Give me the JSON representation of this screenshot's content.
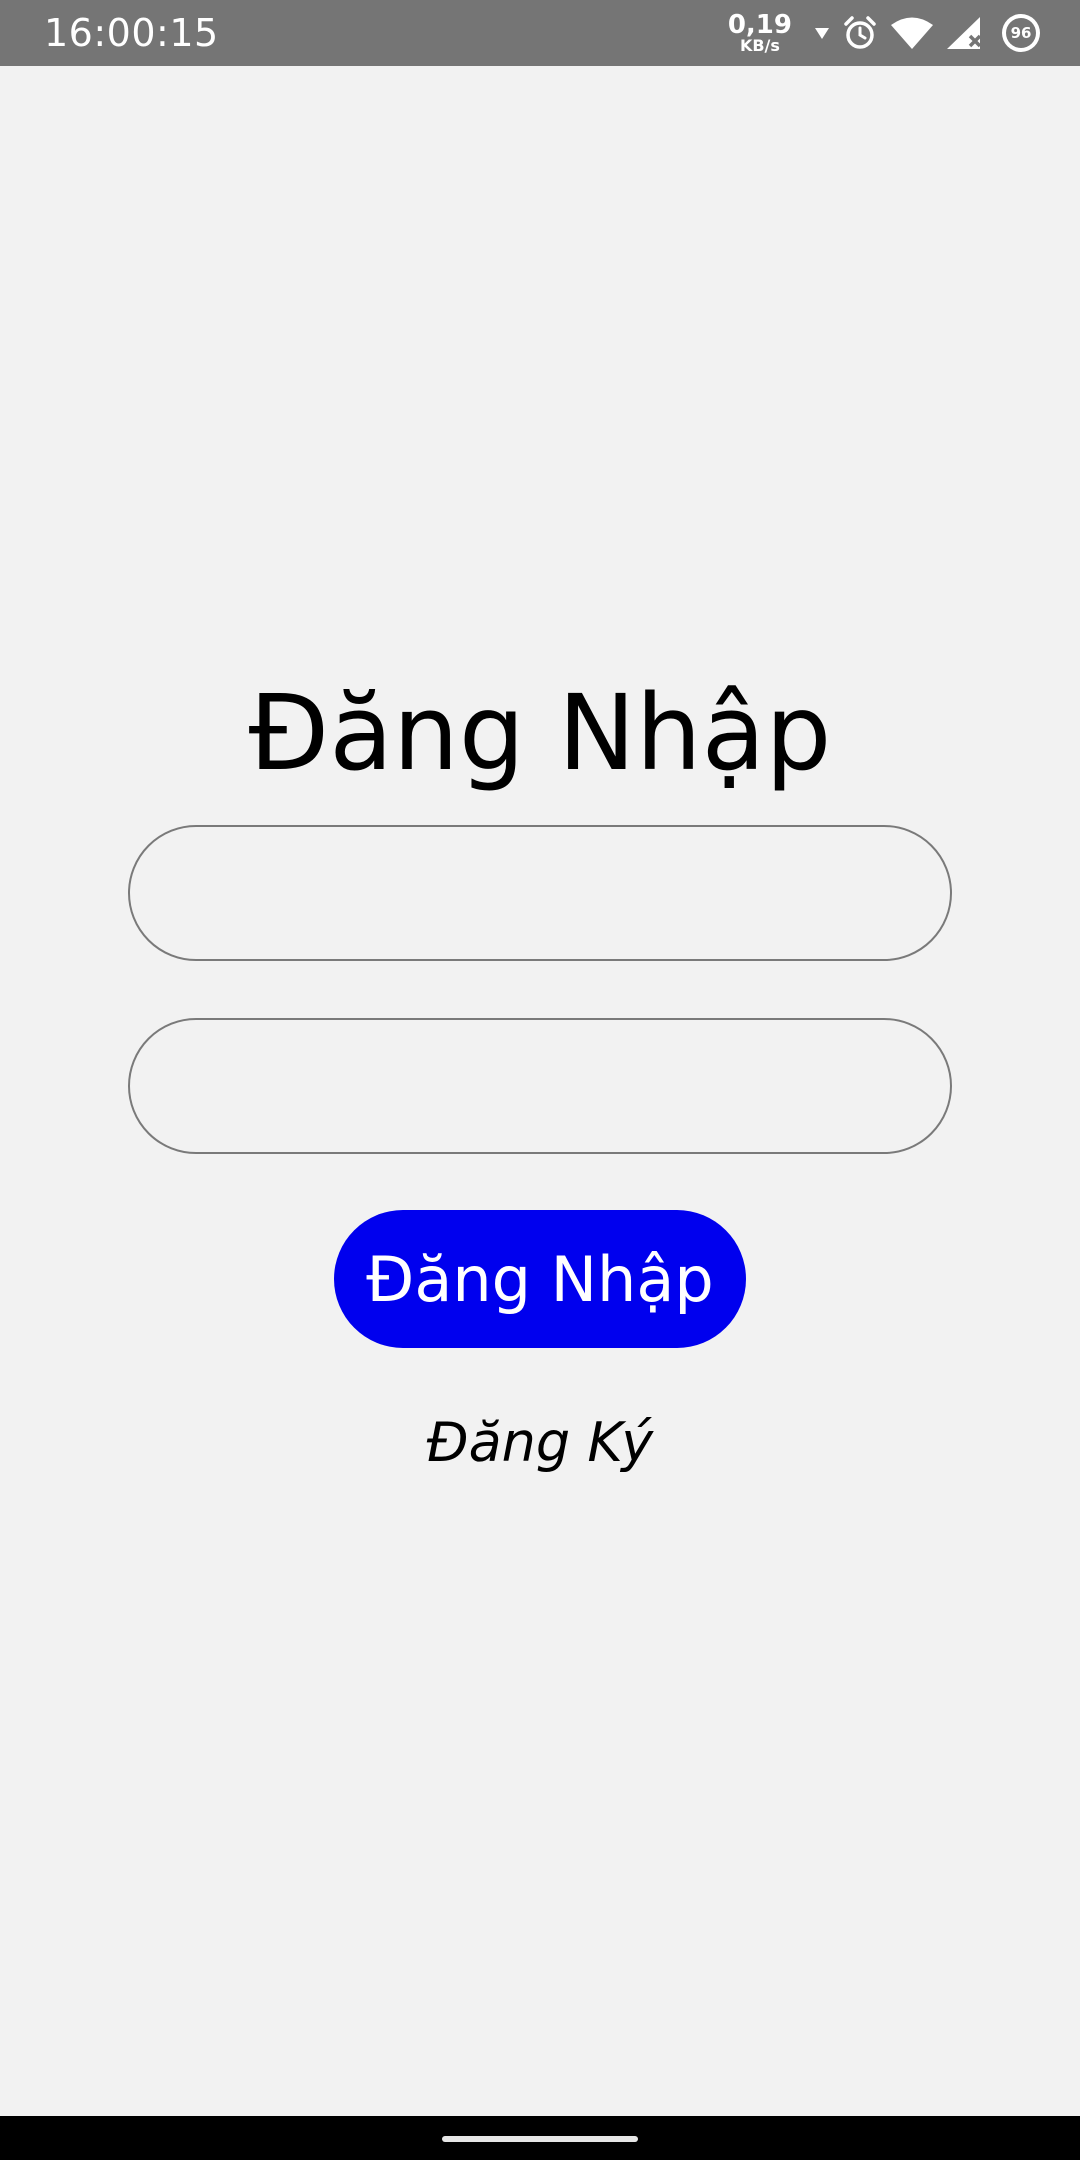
{
  "status_bar": {
    "time": "16:00:15",
    "network_speed_value": "0,19",
    "network_speed_unit": "KB/s",
    "battery_level": "96",
    "icons": [
      "data-arrow-icon",
      "alarm-icon",
      "wifi-icon",
      "signal-no-service-icon",
      "battery-icon"
    ]
  },
  "login": {
    "title": "Đăng Nhập",
    "username_value": "",
    "password_value": "",
    "submit_label": "Đăng Nhập",
    "register_label": "Đăng Ký"
  },
  "colors": {
    "background": "#f2f2f2",
    "status_bar": "#757575",
    "button": "#0000ee",
    "input_border": "#7a7a7a",
    "nav_bar": "#000000"
  }
}
